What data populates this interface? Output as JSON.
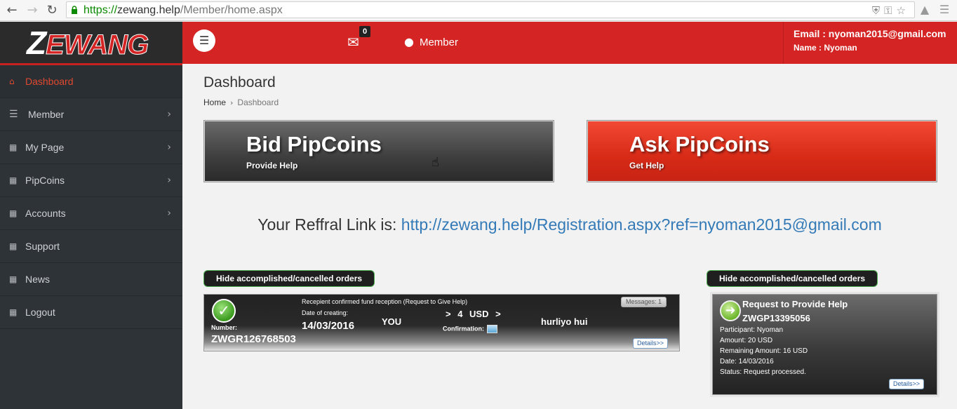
{
  "browser": {
    "url_scheme": "https://",
    "url_host": "zewang.help",
    "url_path": "/Member/home.aspx"
  },
  "brand": {
    "logo_first": "Z",
    "logo_rest": "EWANG"
  },
  "header": {
    "mail_count": "0",
    "member_label": "Member",
    "email": "Email : nyoman2015@gmail.com",
    "name": "Name : Nyoman"
  },
  "sidebar": {
    "items": [
      {
        "label": "Dashboard",
        "icon": "home-icon",
        "active": true
      },
      {
        "label": "Member",
        "icon": "bars-icon",
        "has_children": true
      },
      {
        "label": "My Page",
        "icon": "table-icon",
        "has_children": true
      },
      {
        "label": "PipCoins",
        "icon": "table-icon",
        "has_children": true
      },
      {
        "label": "Accounts",
        "icon": "table-icon",
        "has_children": true
      },
      {
        "label": "Support",
        "icon": "table-icon"
      },
      {
        "label": "News",
        "icon": "table-icon"
      },
      {
        "label": "Logout",
        "icon": "table-icon"
      }
    ]
  },
  "main": {
    "title": "Dashboard",
    "breadcrumb": {
      "home": "Home",
      "current": "Dashboard"
    },
    "bid": {
      "title": "Bid PipCoins",
      "subtitle": "Provide Help"
    },
    "ask": {
      "title": "Ask PipCoins",
      "subtitle": "Get Help"
    },
    "referral": {
      "prefix": "Your Reffral Link is: ",
      "link": "http://zewang.help/Registration.aspx?ref=nyoman2015@gmail.com"
    },
    "hide_left": "Hide accomplished/cancelled orders",
    "hide_right": "Hide accomplished/cancelled orders"
  },
  "order": {
    "number_label": "Number:",
    "number": "ZWGR126768503",
    "status": "Recepient confirmed fund reception (Request to Give Help)",
    "date_label": "Date of creating:",
    "date": "14/03/2016",
    "sender": "YOU",
    "amount": "> 4 USD >",
    "confirmation_label": "Confirmation:",
    "receiver": "hurliyo hui",
    "messages": "Messages: 1",
    "details": "Details>>"
  },
  "request": {
    "title": "Request to Provide Help",
    "id": "ZWGP13395056",
    "participant": "Participant: Nyoman",
    "amount": "Amount: 20 USD",
    "remaining": "Remaining Amount: 16 USD",
    "date": "Date: 14/03/2016",
    "status": "Status: Request processed.",
    "details": "Details>>"
  },
  "colors": {
    "brand_red": "#d42424",
    "sidebar_bg": "#2e3338",
    "active_item": "#e0482f",
    "link_blue": "#337ab7"
  }
}
